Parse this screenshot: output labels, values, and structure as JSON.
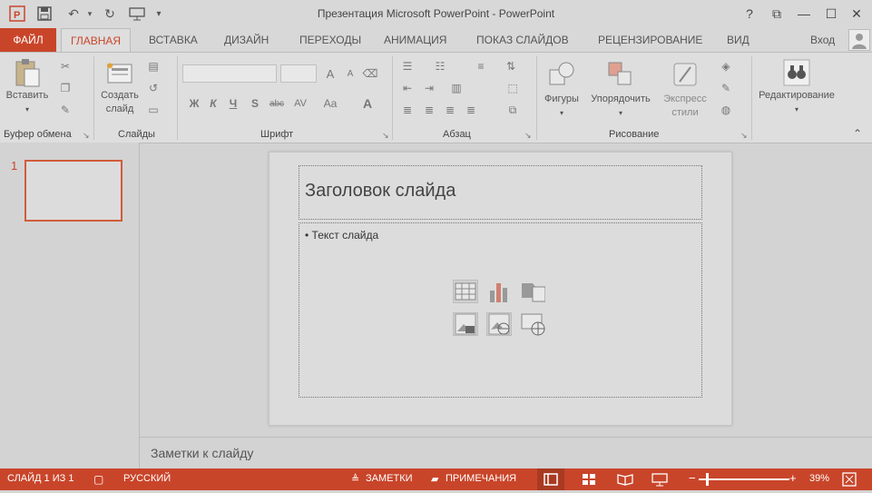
{
  "window": {
    "title": "Презентация Microsoft PowerPoint - PowerPoint",
    "help": "?",
    "controls": {
      "ribbon_display": "⧉",
      "minimize": "—",
      "maximize": "☐",
      "close": "✕"
    }
  },
  "qat": {
    "undo": "↶",
    "redo": "↻"
  },
  "tabs": {
    "file": "ФАЙЛ",
    "items": [
      "ГЛАВНАЯ",
      "ВСТАВКА",
      "ДИЗАЙН",
      "ПЕРЕХОДЫ",
      "АНИМАЦИЯ",
      "ПОКАЗ СЛАЙДОВ",
      "РЕЦЕНЗИРОВАНИЕ",
      "ВИД"
    ],
    "signin": "Вход"
  },
  "ribbon": {
    "clipboard": {
      "paste": "Вставить",
      "label": "Буфер обмена"
    },
    "slides": {
      "new_slide_line1": "Создать",
      "new_slide_line2": "слайд",
      "label": "Слайды"
    },
    "font": {
      "label": "Шрифт",
      "bold": "Ж",
      "italic": "К",
      "underline": "Ч",
      "shadow": "S",
      "strike": "abc",
      "spacing": "AV",
      "case": "Aa",
      "grow": "A",
      "shrink": "A",
      "color": "A"
    },
    "paragraph": {
      "label": "Абзац"
    },
    "drawing": {
      "shapes": "Фигуры",
      "arrange": "Упорядочить",
      "quick_styles_line1": "Экспресс",
      "quick_styles_line2": "стили",
      "label": "Рисование"
    },
    "editing": {
      "label": "Редактирование"
    }
  },
  "slide_panel": {
    "number": "1"
  },
  "slide": {
    "title_placeholder": "Заголовок слайда",
    "body_placeholder": "• Текст слайда"
  },
  "notes": {
    "placeholder": "Заметки к слайду"
  },
  "status": {
    "slide_counter": "СЛАЙД 1 ИЗ 1",
    "language": "РУССКИЙ",
    "notes": "ЗАМЕТКИ",
    "comments": "ПРИМЕЧАНИЯ",
    "zoom_minus": "−",
    "zoom_plus": "+",
    "zoom_level": "39%"
  },
  "colors": {
    "accent": "#c9452a",
    "background": "#d3d3d3"
  }
}
